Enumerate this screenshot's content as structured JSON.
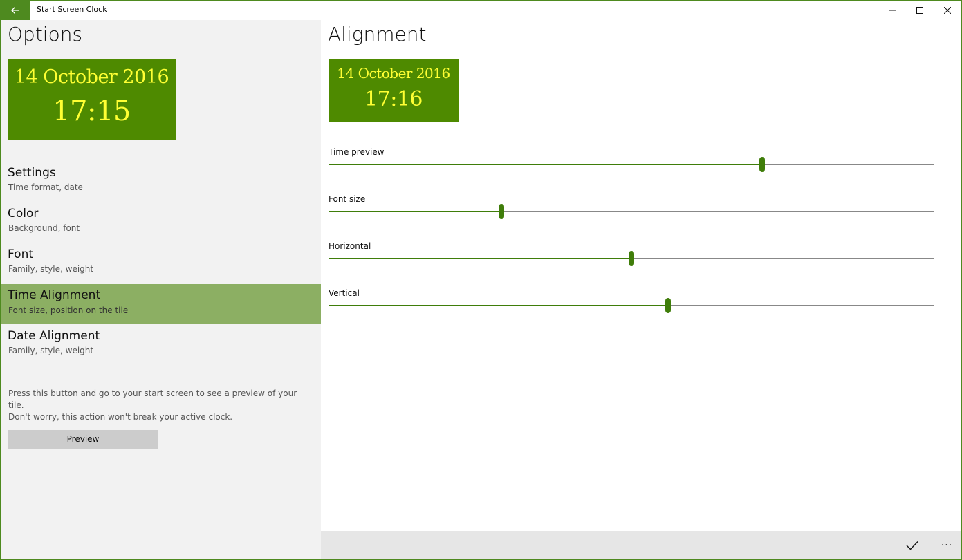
{
  "window": {
    "title": "Start Screen Clock",
    "accent_color": "#4e8a1f"
  },
  "left": {
    "heading": "Options",
    "tile": {
      "date": "14 October 2016",
      "time": "17:15",
      "background": "#4e8a00",
      "font_color": "#ffff33"
    },
    "nav_items": [
      {
        "label": "Settings",
        "sub": "Time format, date",
        "selected": false
      },
      {
        "label": "Color",
        "sub": "Background, font",
        "selected": false
      },
      {
        "label": "Font",
        "sub": "Family, style, weight",
        "selected": false
      },
      {
        "label": "Time Alignment",
        "sub": "Font size, position on the tile",
        "selected": true
      },
      {
        "label": "Date Alignment",
        "sub": "Family, style, weight",
        "selected": false
      }
    ],
    "help_line1": "Press this button and go to your start screen to see a preview of your tile.",
    "help_line2": "Don't worry, this action won't break your active clock.",
    "preview_label": "Preview"
  },
  "right": {
    "heading": "Alignment",
    "tile": {
      "date": "14 October 2016",
      "time": "17:16"
    },
    "sliders": [
      {
        "label": "Time preview",
        "value_fraction": 0.717
      },
      {
        "label": "Font size",
        "value_fraction": 0.286
      },
      {
        "label": "Horizontal",
        "value_fraction": 0.5
      },
      {
        "label": "Vertical",
        "value_fraction": 0.561
      }
    ]
  },
  "command_bar": {
    "accept_icon": "checkmark-icon",
    "more_icon": "more-icon",
    "more_glyph": "···"
  }
}
